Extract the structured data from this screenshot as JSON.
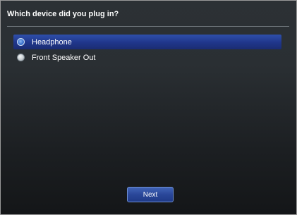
{
  "dialog": {
    "title": "Which device did you plug in?",
    "options": [
      {
        "label": "Headphone",
        "selected": true
      },
      {
        "label": "Front Speaker Out",
        "selected": false
      }
    ],
    "next_label": "Next"
  }
}
